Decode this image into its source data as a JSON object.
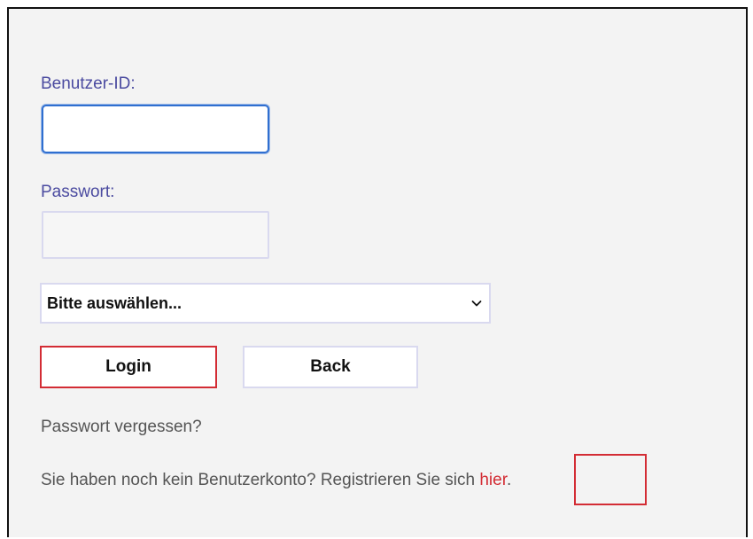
{
  "form": {
    "user_id_label": "Benutzer-ID:",
    "user_id_value": "",
    "password_label": "Passwort:",
    "password_value": "",
    "select_value": "Bitte auswählen...",
    "login_label": "Login",
    "back_label": "Back",
    "forgot_password": "Passwort vergessen?",
    "register_text": "Sie haben noch kein Benutzerkonto? Registrieren Sie sich ",
    "register_link": "hier",
    "register_suffix": "."
  },
  "colors": {
    "label": "#4b4ba0",
    "focus_border": "#2f6fd0",
    "highlight_red": "#d32c34",
    "background": "#f3f3f3"
  },
  "icons": {
    "select_arrow": "chevron-down-icon"
  }
}
